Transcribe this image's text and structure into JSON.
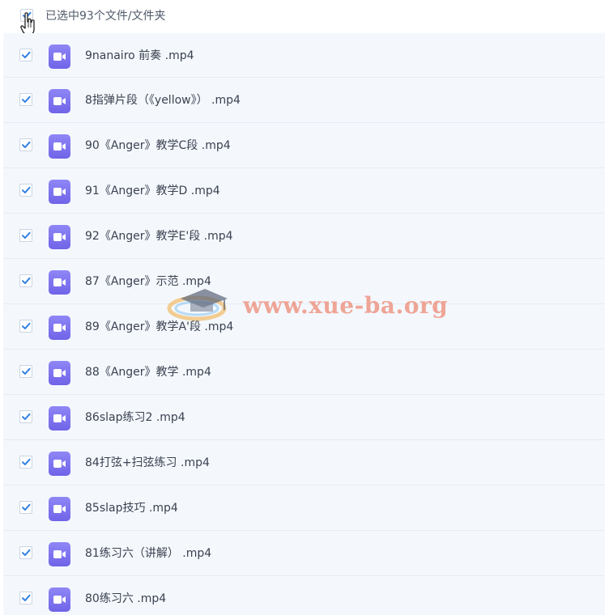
{
  "header": {
    "selected_text": "已选中93个文件/文件夹",
    "all_checked": true
  },
  "files": [
    {
      "name": "9nanairo 前奏 .mp4",
      "checked": true,
      "icon": "video-file-icon"
    },
    {
      "name": "8指弹片段（《yellow》） .mp4",
      "checked": true,
      "icon": "video-file-icon"
    },
    {
      "name": "90《Anger》教学C段 .mp4",
      "checked": true,
      "icon": "video-file-icon"
    },
    {
      "name": "91《Anger》教学D .mp4",
      "checked": true,
      "icon": "video-file-icon"
    },
    {
      "name": "92《Anger》教学E'段 .mp4",
      "checked": true,
      "icon": "video-file-icon"
    },
    {
      "name": "87《Anger》示范 .mp4",
      "checked": true,
      "icon": "video-file-icon"
    },
    {
      "name": "89《Anger》教学A'段 .mp4",
      "checked": true,
      "icon": "video-file-icon"
    },
    {
      "name": "88《Anger》教学 .mp4",
      "checked": true,
      "icon": "video-file-icon"
    },
    {
      "name": "86slap练习2 .mp4",
      "checked": true,
      "icon": "video-file-icon"
    },
    {
      "name": "84打弦+扫弦练习 .mp4",
      "checked": true,
      "icon": "video-file-icon"
    },
    {
      "name": "85slap技巧 .mp4",
      "checked": true,
      "icon": "video-file-icon"
    },
    {
      "name": "81练习六（讲解） .mp4",
      "checked": true,
      "icon": "video-file-icon"
    },
    {
      "name": "80练习六 .mp4",
      "checked": true,
      "icon": "video-file-icon"
    }
  ],
  "watermark": {
    "text": "www.xue-ba.org"
  },
  "colors": {
    "checkbox_check": "#2f7fe8",
    "video_icon": "#7b70ef",
    "list_background": "#f4f8fd",
    "row_divider": "#e4ecf5",
    "watermark": "#ec7860"
  }
}
